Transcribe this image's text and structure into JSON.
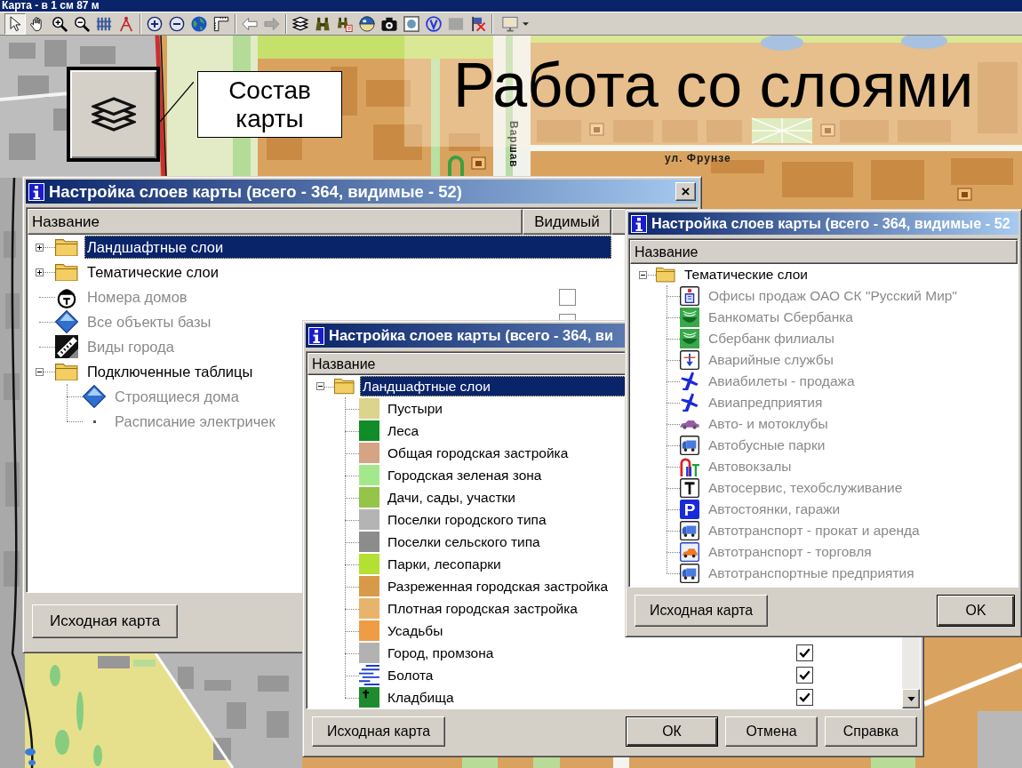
{
  "window": {
    "title": "Карта - в 1 см 87 м"
  },
  "toolbar": {
    "groups": [
      [
        {
          "kind": "pointer",
          "selected": true,
          "disabled": false
        },
        {
          "kind": "hand",
          "selected": false,
          "disabled": false
        },
        {
          "kind": "zoom-in",
          "selected": false,
          "disabled": false
        },
        {
          "kind": "zoom-out",
          "selected": false,
          "disabled": false
        },
        {
          "kind": "fence",
          "selected": false,
          "disabled": false
        },
        {
          "kind": "compass",
          "selected": false,
          "disabled": false
        }
      ],
      [
        {
          "kind": "plus",
          "selected": false,
          "disabled": false
        },
        {
          "kind": "minus",
          "selected": false,
          "disabled": false
        },
        {
          "kind": "globe",
          "selected": false,
          "disabled": false
        },
        {
          "kind": "ruler",
          "selected": false,
          "disabled": false
        }
      ],
      [
        {
          "kind": "back",
          "selected": false,
          "disabled": false
        },
        {
          "kind": "forward",
          "selected": false,
          "disabled": true
        }
      ],
      [
        {
          "kind": "layers",
          "selected": false,
          "disabled": false
        },
        {
          "kind": "binoculars",
          "selected": false,
          "disabled": false
        },
        {
          "kind": "binoculars-page",
          "selected": false,
          "disabled": false
        },
        {
          "kind": "sphere",
          "selected": false,
          "disabled": false
        },
        {
          "kind": "camera",
          "selected": false,
          "disabled": false
        },
        {
          "kind": "frame",
          "selected": false,
          "disabled": false
        },
        {
          "kind": "v-mark",
          "selected": false,
          "disabled": false
        },
        {
          "kind": "square",
          "selected": false,
          "disabled": false
        },
        {
          "kind": "flag-cross",
          "selected": false,
          "disabled": false
        }
      ],
      [
        {
          "kind": "monitor-menu",
          "selected": false,
          "disabled": false
        }
      ]
    ]
  },
  "map": {
    "labels": [
      {
        "kind": "vertical",
        "text": "Варшав"
      },
      {
        "kind": "horizontal",
        "text": "ул. Фрунзе"
      }
    ]
  },
  "slide": {
    "title": "Работа со слоями",
    "callout": "Состав карты"
  },
  "dialogs": [
    {
      "title": "Настройка слоев карты (всего - 364, видимые - 52)",
      "close": "×",
      "columns": [
        "Название",
        "Видимый"
      ],
      "tree": [
        {
          "label": "Ландшафтные слои",
          "kind": "folder",
          "expanded": false,
          "selected": true,
          "disabled": false
        },
        {
          "label": "Тематические слои",
          "kind": "folder",
          "expanded": false,
          "selected": false,
          "disabled": false
        },
        {
          "label": "Номера домов",
          "kind": "marker",
          "selected": false,
          "disabled": true,
          "checked": false
        },
        {
          "label": "Все объекты базы",
          "kind": "diamond",
          "selected": false,
          "disabled": true,
          "checked": false
        },
        {
          "label": "Виды города",
          "kind": "film",
          "selected": false,
          "disabled": true
        },
        {
          "label": "Подключенные таблицы",
          "kind": "folder",
          "expanded": true,
          "selected": false,
          "disabled": false,
          "children": [
            {
              "label": "Строящиеся дома",
              "kind": "diamond",
              "selected": false,
              "disabled": true
            },
            {
              "label": "Расписание электричек",
              "kind": "dot",
              "selected": false,
              "disabled": true
            }
          ]
        }
      ],
      "buttons": [
        {
          "label": "Исходная карта",
          "default": false
        }
      ]
    },
    {
      "title": "Настройка слоев карты (всего - 364, ви",
      "columns": [
        "Название"
      ],
      "scrollbar": true,
      "tree": [
        {
          "label": "Ландшафтные слои",
          "kind": "folder",
          "expanded": true,
          "selected": true,
          "disabled": false,
          "children": [
            {
              "label": "Пустыри",
              "kind": "swatch",
              "color": "#dcd48c",
              "selected": false,
              "disabled": false
            },
            {
              "label": "Леса",
              "kind": "swatch",
              "color": "#108c28",
              "selected": false,
              "disabled": false
            },
            {
              "label": "Общая городская застройка",
              "kind": "swatch",
              "color": "#d4a484",
              "selected": false,
              "disabled": false
            },
            {
              "label": "Городская зеленая зона",
              "kind": "swatch",
              "color": "#a4e88c",
              "selected": false,
              "disabled": false
            },
            {
              "label": "Дачи, сады, участки",
              "kind": "swatch",
              "color": "#94c448",
              "selected": false,
              "disabled": false
            },
            {
              "label": "Поселки городского типа",
              "kind": "swatch",
              "color": "#b4b4b4",
              "selected": false,
              "disabled": false
            },
            {
              "label": "Поселки сельского типа",
              "kind": "swatch",
              "color": "#8c8c8c",
              "selected": false,
              "disabled": false
            },
            {
              "label": "Парки, лесопарки",
              "kind": "swatch",
              "color": "#b4e034",
              "selected": false,
              "disabled": false
            },
            {
              "label": "Разреженная городская застройка",
              "kind": "swatch",
              "color": "#d89a48",
              "selected": false,
              "disabled": false
            },
            {
              "label": "Плотная городская застройка",
              "kind": "swatch",
              "color": "#e8b46c",
              "selected": false,
              "disabled": false
            },
            {
              "label": "Усадьбы",
              "kind": "swatch",
              "color": "#f09c44",
              "selected": false,
              "disabled": false
            },
            {
              "label": "Город, промзона",
              "kind": "swatch",
              "color": "#b2b2b2",
              "selected": false,
              "disabled": false,
              "checked": true
            },
            {
              "label": "Болота",
              "kind": "hatch",
              "selected": false,
              "disabled": false,
              "checked": true
            },
            {
              "label": "Кладбища",
              "kind": "cross",
              "selected": false,
              "disabled": false,
              "checked": true
            }
          ]
        }
      ],
      "buttons": [
        {
          "label": "Исходная карта",
          "default": false
        },
        {
          "label": "ОК",
          "default": true
        },
        {
          "label": "Отмена",
          "default": false
        },
        {
          "label": "Справка",
          "default": false
        }
      ]
    },
    {
      "title": "Настройка слоев карты (всего - 364, видимые - 52",
      "columns": [
        "Название"
      ],
      "tree": [
        {
          "label": "Тематические слои",
          "kind": "folder",
          "expanded": true,
          "selected": false,
          "disabled": false,
          "children": [
            {
              "label": "Офисы продаж ОАО СК \"Русский Мир\"",
              "kind": "building",
              "selected": false,
              "disabled": true
            },
            {
              "label": "Банкоматы Сбербанка",
              "kind": "emblem",
              "selected": false,
              "disabled": true
            },
            {
              "label": "Сбербанк филиалы",
              "kind": "emblem",
              "selected": false,
              "disabled": true
            },
            {
              "label": "Аварийные службы",
              "kind": "tool",
              "selected": false,
              "disabled": true
            },
            {
              "label": "Авиабилеты - продажа",
              "kind": "plane",
              "selected": false,
              "disabled": true
            },
            {
              "label": "Авиапредприятия",
              "kind": "plane",
              "selected": false,
              "disabled": true
            },
            {
              "label": "Авто- и мотоклубы",
              "kind": "car",
              "selected": false,
              "disabled": true
            },
            {
              "label": "Автобусные парки",
              "kind": "truck",
              "selected": false,
              "disabled": true
            },
            {
              "label": "Автовокзалы",
              "kind": "arch",
              "selected": false,
              "disabled": true
            },
            {
              "label": "Автосервис, техобслуживание",
              "kind": "hammer",
              "selected": false,
              "disabled": true
            },
            {
              "label": "Автостоянки, гаражи",
              "kind": "parking",
              "glyph": "P",
              "selected": false,
              "disabled": true
            },
            {
              "label": "Автотранспорт - прокат и аренда",
              "kind": "truck",
              "selected": false,
              "disabled": true
            },
            {
              "label": "Автотранспорт - торговля",
              "kind": "car-box",
              "selected": false,
              "disabled": true
            },
            {
              "label": "Автотранспортные предприятия",
              "kind": "truck",
              "selected": false,
              "disabled": true
            }
          ]
        }
      ],
      "buttons": [
        {
          "label": "Исходная карта",
          "default": false
        },
        {
          "label": "OK",
          "default": true
        }
      ]
    }
  ]
}
